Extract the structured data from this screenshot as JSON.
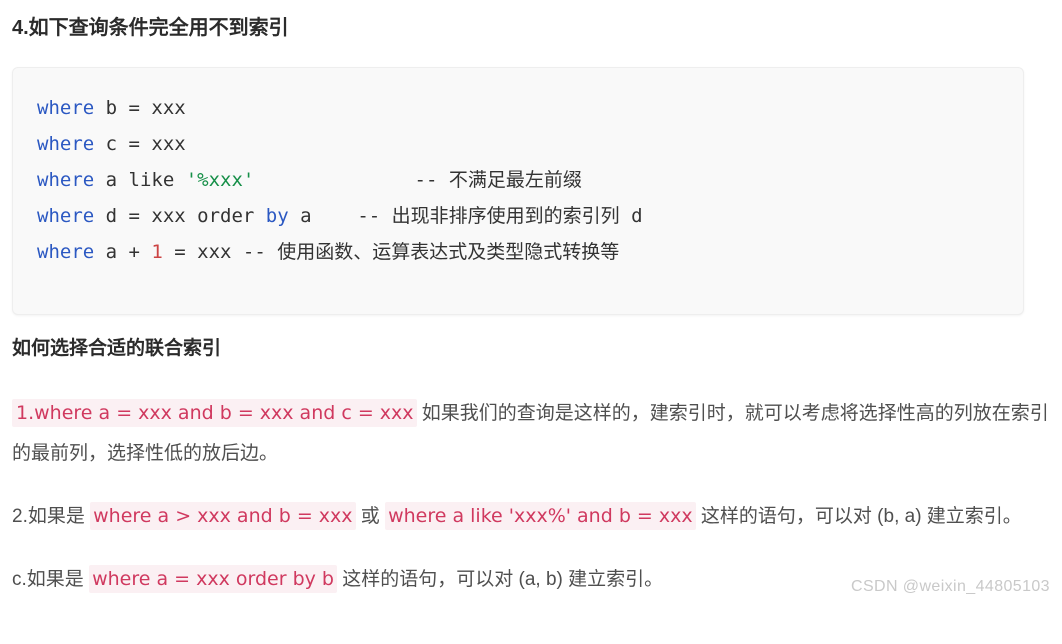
{
  "section": {
    "title": "4.如下查询条件完全用不到索引"
  },
  "code_block": {
    "language": "sql",
    "lines": [
      [
        {
          "t": "where",
          "c": "kw"
        },
        {
          "t": " b = xxx",
          "c": "plain"
        }
      ],
      [
        {
          "t": "where",
          "c": "kw"
        },
        {
          "t": " c = xxx",
          "c": "plain"
        }
      ],
      [
        {
          "t": "where",
          "c": "kw"
        },
        {
          "t": " a like ",
          "c": "plain"
        },
        {
          "t": "'%xxx'",
          "c": "str"
        },
        {
          "t": "              -- 不满足最左前缀",
          "c": "cmt"
        }
      ],
      [
        {
          "t": "where",
          "c": "kw"
        },
        {
          "t": " d = xxx order ",
          "c": "plain"
        },
        {
          "t": "by",
          "c": "kw"
        },
        {
          "t": " a    -- 出现非排序使用到的索引列 d",
          "c": "cmt"
        }
      ],
      [
        {
          "t": "where",
          "c": "kw"
        },
        {
          "t": " a + ",
          "c": "plain"
        },
        {
          "t": "1",
          "c": "num"
        },
        {
          "t": " = xxx -- 使用函数、运算表达式及类型隐式转换等",
          "c": "cmt"
        }
      ]
    ]
  },
  "subsection": {
    "title": "如何选择合适的联合索引"
  },
  "paragraphs": [
    {
      "id": "p1",
      "code_lead": "1.where a = xxx and b = xxx and c = xxx",
      "text": " 如果我们的查询是这样的，建索引时，就可以考虑将选择性高的列放在索引的最前列，选择性低的放后边。"
    },
    {
      "id": "p2",
      "prefix": "2.如果是 ",
      "code_a": "where a > xxx and b = xxx",
      "mid": " 或 ",
      "code_b": "where a like 'xxx%' and b = xxx",
      "suffix": " 这样的语句，可以对 (b, a) 建立索引。"
    },
    {
      "id": "p3",
      "prefix": "c.如果是 ",
      "code_a": "where a = xxx order by b",
      "suffix": " 这样的语句，可以对 (a, b) 建立索引。"
    }
  ],
  "watermark": {
    "text": "CSDN @weixin_44805103"
  },
  "colors": {
    "keyword": "#2b58c2",
    "string": "#168f48",
    "number": "#cc4444",
    "inline_code_text": "#d0395f",
    "inline_code_bg": "#fbf0f3",
    "code_block_bg": "#f9f9f9",
    "body_text": "#4f4f4f",
    "heading_text": "#2b2b2b",
    "watermark": "#c9c9c9"
  }
}
